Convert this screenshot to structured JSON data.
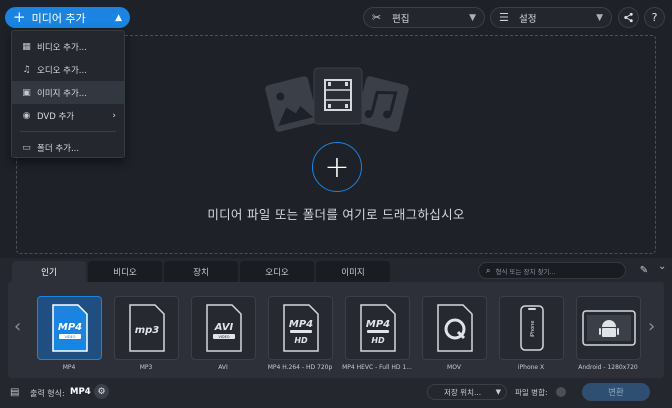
{
  "toolbar": {
    "add_media_label": "미디어 추가",
    "edit_label": "편집",
    "settings_label": "설정"
  },
  "add_menu": {
    "items": [
      {
        "label": "비디오 추가...",
        "icon": "film-icon"
      },
      {
        "label": "오디오 추가...",
        "icon": "music-note-icon"
      },
      {
        "label": "이미지 추가...",
        "icon": "image-icon"
      },
      {
        "label": "DVD 추가",
        "icon": "disc-icon"
      },
      {
        "label": "폴더 추가...",
        "icon": "folder-icon"
      }
    ]
  },
  "dropzone": {
    "text": "미디어 파일 또는 폴더를 여기로 드래그하십시오"
  },
  "tabs": [
    {
      "label": "인기",
      "active": true
    },
    {
      "label": "비디오",
      "active": false
    },
    {
      "label": "장치",
      "active": false
    },
    {
      "label": "오디오",
      "active": false
    },
    {
      "label": "이미지",
      "active": false
    }
  ],
  "search": {
    "placeholder": "형식 또는 장치 찾기..."
  },
  "formats": [
    {
      "label": "MP4",
      "title": "MP4",
      "sub": "VIDEO",
      "active": true
    },
    {
      "label": "MP3",
      "title": "mp3",
      "sub": "",
      "active": false
    },
    {
      "label": "AVI",
      "title": "AVI",
      "sub": "VIDEO",
      "active": false
    },
    {
      "label": "MP4 H.264 - HD 720p",
      "title": "MP4",
      "sub": "HD",
      "active": false
    },
    {
      "label": "MP4 HEVC - Full HD 1...",
      "title": "MP4",
      "sub": "HD",
      "active": false
    },
    {
      "label": "MOV",
      "title": "Q",
      "sub": "",
      "active": false
    },
    {
      "label": "iPhone X",
      "title": "iPhone",
      "sub": "",
      "active": false
    },
    {
      "label": "Android - 1280x720",
      "title": "android",
      "sub": "",
      "active": false
    }
  ],
  "footer": {
    "output_label": "출력 형식:",
    "output_value": "MP4",
    "save_to": "저장 위치...",
    "merge_label": "파일 병합:",
    "convert_label": "변환"
  },
  "colors": {
    "accent": "#1a84e0",
    "background": "#1e2127",
    "panel": "#24272e"
  }
}
